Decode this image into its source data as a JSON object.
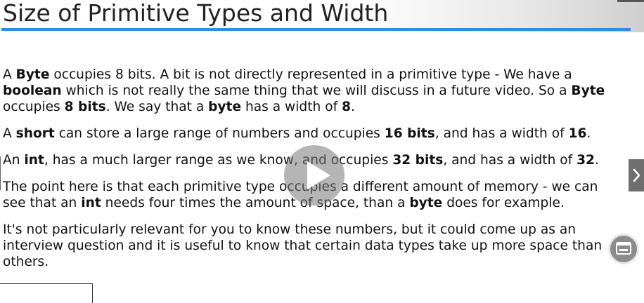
{
  "slide": {
    "title": "Size of Primitive Types and Width",
    "paragraphs": [
      [
        {
          "t": "A "
        },
        {
          "t": "Byte",
          "b": true
        },
        {
          "t": " occupies 8 bits. A bit is not directly represented in a primitive type - We have a "
        },
        {
          "t": "boolean",
          "b": true
        },
        {
          "t": " which is not really the same thing that we will discuss in a future video. So a "
        },
        {
          "t": "Byte",
          "b": true
        },
        {
          "t": " occupies "
        },
        {
          "t": "8 bits",
          "b": true
        },
        {
          "t": ". We say that a "
        },
        {
          "t": "byte",
          "b": true
        },
        {
          "t": " has a width of "
        },
        {
          "t": "8",
          "b": true
        },
        {
          "t": "."
        }
      ],
      [
        {
          "t": "A "
        },
        {
          "t": "short",
          "b": true
        },
        {
          "t": " can store a large range of numbers and occupies "
        },
        {
          "t": "16 bits",
          "b": true
        },
        {
          "t": ", and has a width of "
        },
        {
          "t": "16",
          "b": true
        },
        {
          "t": "."
        }
      ],
      [
        {
          "t": "An "
        },
        {
          "t": "int",
          "b": true
        },
        {
          "t": ", has a much larger range as we know, and occupies "
        },
        {
          "t": "32 bits",
          "b": true
        },
        {
          "t": ", and has a width of "
        },
        {
          "t": "32",
          "b": true
        },
        {
          "t": "."
        }
      ],
      [
        {
          "t": "The point here is that each primitive type occupies a different amount of memory - we can see that an "
        },
        {
          "t": "int",
          "b": true
        },
        {
          "t": " needs four times the amount of space, than a "
        },
        {
          "t": "byte",
          "b": true
        },
        {
          "t": " does for example."
        }
      ],
      [
        {
          "t": "It's not particularly relevant for you to know these numbers, but it could come up as an interview question and it is useful to know that certain data types take up more space than others."
        }
      ]
    ]
  },
  "controls": {
    "play_icon": "play-icon",
    "next_icon": "chevron-right-icon",
    "side_button_icon": "window-icon"
  },
  "colors": {
    "accent_underline": "#2f8ee0",
    "overlay_gray": "#7a7a7a"
  }
}
